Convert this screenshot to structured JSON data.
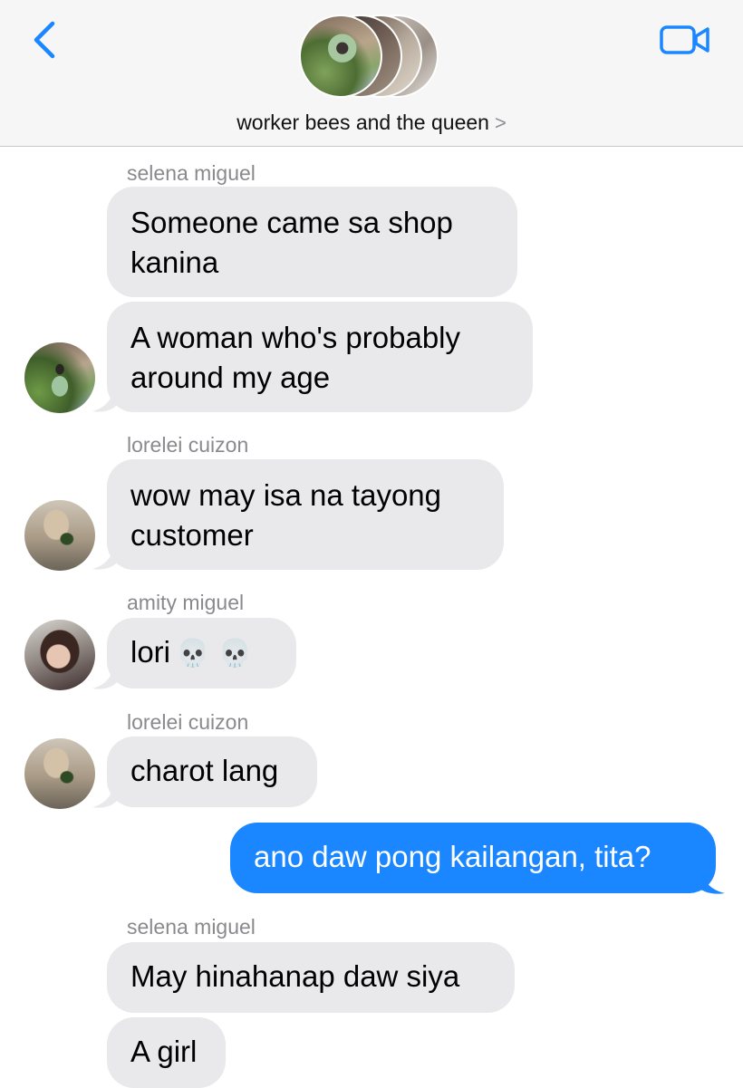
{
  "header": {
    "group_name": "worker bees and the queen",
    "title_chevron": ">",
    "back_icon": "chevron-left-icon",
    "video_icon": "video-camera-icon",
    "accent_color": "#1a86ff"
  },
  "messages": [
    {
      "sender": "selena miguel",
      "text": "Someone came sa shop kanina"
    },
    {
      "text": "A woman who's probably around my age"
    },
    {
      "sender": "lorelei cuizon",
      "text": "wow may isa na tayong customer"
    },
    {
      "sender": "amity miguel",
      "text": "lori",
      "emoji": "💀 💀"
    },
    {
      "sender": "lorelei cuizon",
      "text": "charot lang"
    },
    {
      "outgoing": true,
      "text": "ano daw pong kailangan, tita?"
    },
    {
      "sender": "selena miguel",
      "text": "May hinahanap daw siya"
    },
    {
      "text": "A girl"
    }
  ]
}
